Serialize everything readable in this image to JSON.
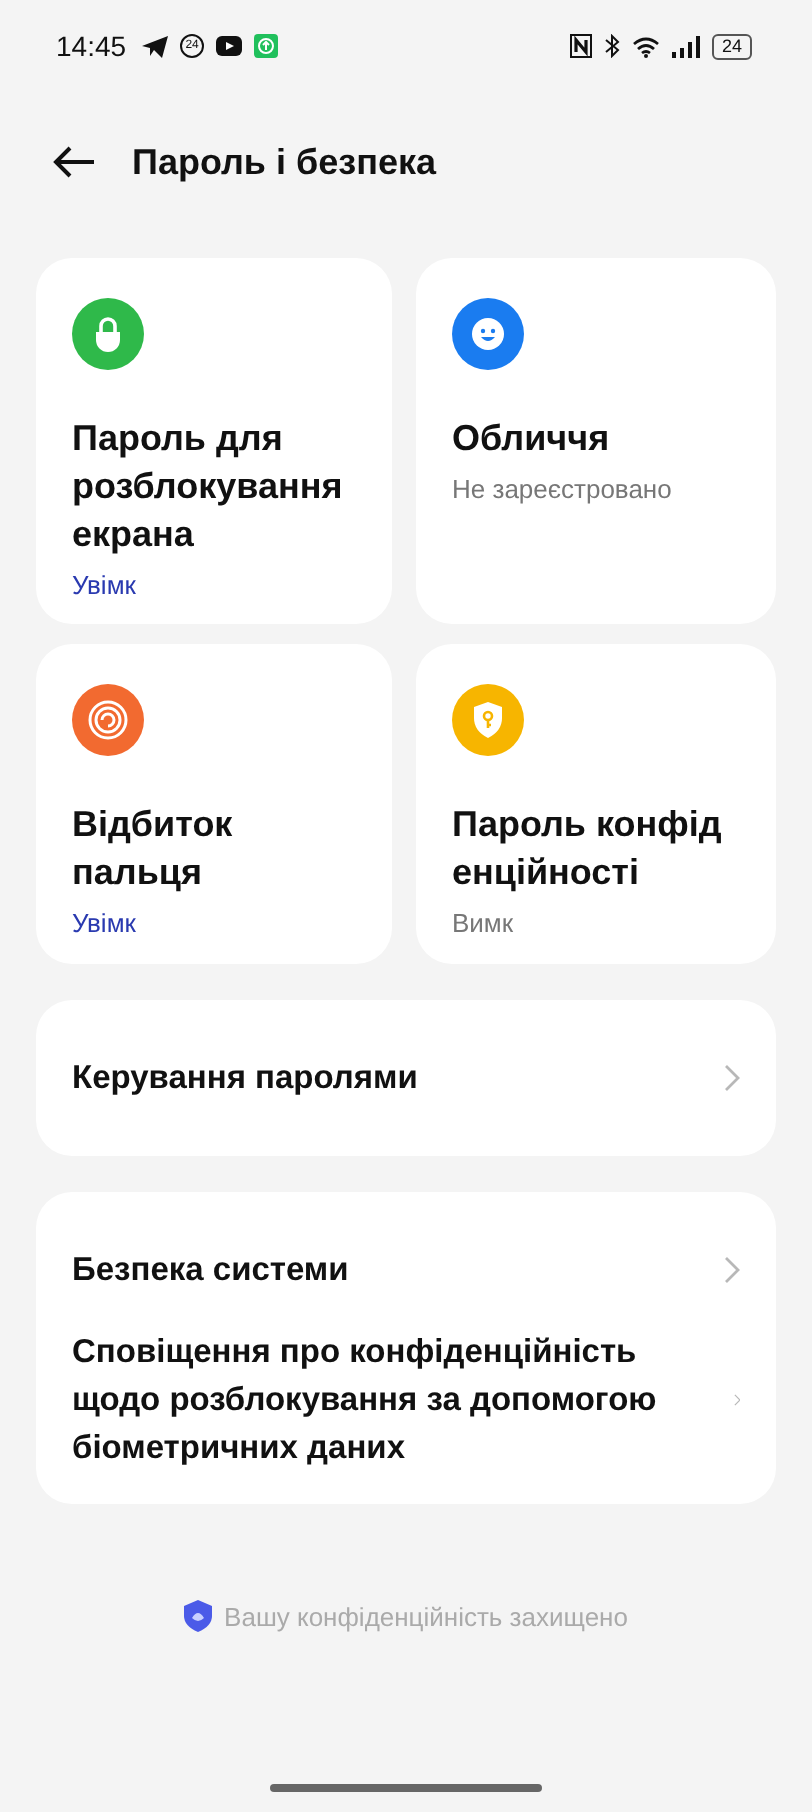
{
  "status_bar": {
    "time": "14:45",
    "news_badge": "24",
    "battery": "24"
  },
  "header": {
    "title": "Пароль і безпека"
  },
  "tiles": [
    {
      "kind": "lock",
      "color": "#2fb94a",
      "title": "Пароль для розблокування екрана",
      "status": "Увімк",
      "on": true
    },
    {
      "kind": "face",
      "color": "#1a7cf0",
      "title": "Обличчя",
      "status": "Не зареєстровано",
      "on": false
    },
    {
      "kind": "fingerprint",
      "color": "#f26a30",
      "title": "Відбиток пальця",
      "status": "Увімк",
      "on": true
    },
    {
      "kind": "key",
      "color": "#f7b500",
      "title": "Пароль конфід енційності",
      "status": "Вимк",
      "on": false
    }
  ],
  "groups": [
    [
      "Керування паролями"
    ],
    [
      "Безпека системи",
      "Сповіщення про конфіденційність щодо розблокування за допомогою біометричних даних"
    ]
  ],
  "footer": "Вашу конфіденційність захищено"
}
